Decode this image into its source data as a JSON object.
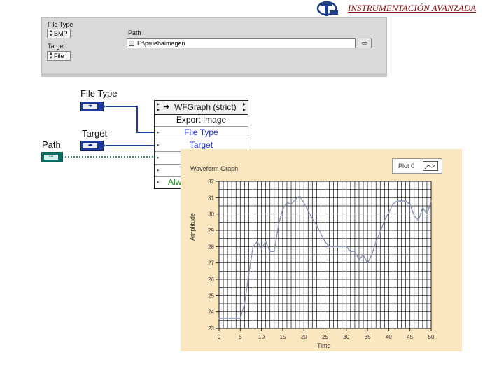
{
  "header": {
    "title": "INSTRUMENTACIÓN AVANZADA"
  },
  "front_panel": {
    "file_type_label": "File Type",
    "file_type_value": "BMP",
    "target_label": "Target",
    "target_value": "File",
    "path_label": "Path",
    "path_value": "E:\\pruebaimagen"
  },
  "block_diagram": {
    "file_type_label": "File Type",
    "target_label": "Target",
    "path_label": "Path",
    "node_title": "WFGraph (strict)",
    "node_rows": [
      "Export Image",
      "File Type",
      "Target",
      "",
      "",
      "Alw"
    ]
  },
  "colors": {
    "accent": "#1e3a9e",
    "path_wire": "#0e6b66",
    "graph_bg": "#fbe7bf",
    "header": "#8b1010"
  },
  "chart_data": {
    "type": "line",
    "title": "Waveform Graph",
    "xlabel": "Time",
    "ylabel": "Amplitude",
    "legend": "Plot 0",
    "xlim": [
      0,
      50
    ],
    "ylim": [
      23,
      32
    ],
    "xticks": [
      0,
      5,
      10,
      15,
      20,
      25,
      30,
      35,
      40,
      45,
      50
    ],
    "yticks": [
      23,
      24,
      25,
      26,
      27,
      28,
      29,
      30,
      31,
      32
    ],
    "grid": true,
    "x": [
      0,
      3,
      5,
      6,
      7,
      8,
      9,
      10,
      11,
      12,
      13,
      14,
      15,
      16,
      17,
      18,
      19,
      20,
      21,
      22,
      23,
      24,
      25,
      26,
      27,
      28,
      29,
      30,
      31,
      32,
      33,
      34,
      35,
      36,
      37,
      38,
      39,
      40,
      41,
      42,
      43,
      44,
      45,
      46,
      47,
      48,
      49,
      50
    ],
    "y": [
      23.6,
      23.6,
      23.6,
      24.5,
      26.3,
      28.0,
      28.3,
      27.9,
      28.3,
      27.7,
      27.7,
      29.3,
      30.3,
      30.7,
      30.6,
      30.9,
      31.1,
      30.7,
      30.2,
      29.7,
      29.3,
      28.8,
      28.3,
      28.0,
      28.0,
      28.0,
      28.0,
      28.0,
      27.7,
      27.7,
      27.2,
      27.5,
      27.0,
      27.5,
      28.3,
      28.9,
      29.6,
      30.1,
      30.6,
      30.8,
      30.8,
      30.8,
      30.6,
      29.9,
      29.6,
      30.4,
      30.0,
      30.8
    ]
  }
}
